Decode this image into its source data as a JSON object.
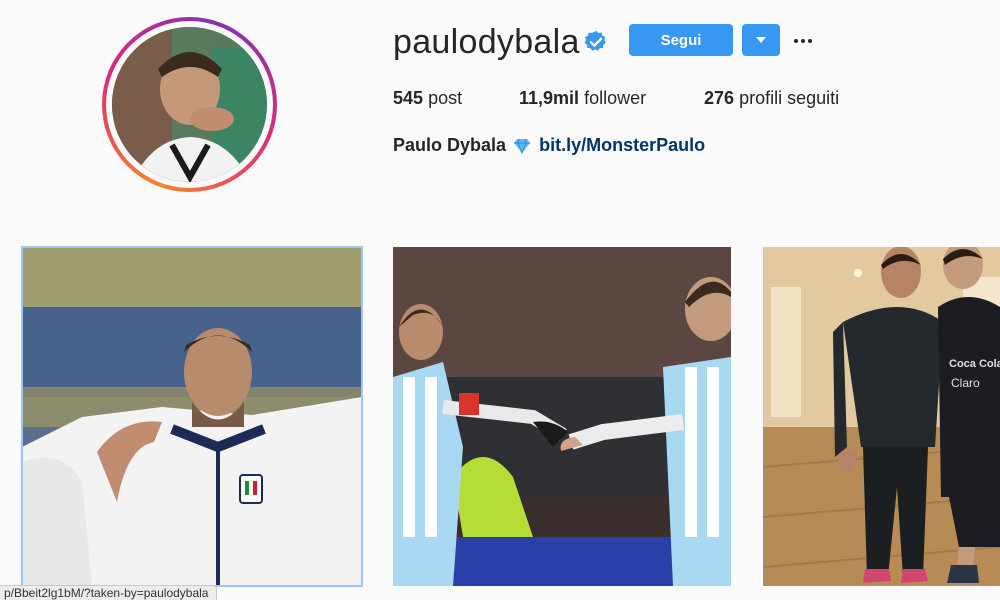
{
  "profile": {
    "username": "paulodybala",
    "verified": true,
    "follow_label": "Segui",
    "dropdown_icon": "chevron-down-icon",
    "more_icon": "more-options-icon",
    "stats": {
      "posts_value": "545",
      "posts_label": "post",
      "followers_value": "11,9mil",
      "followers_label": "follower",
      "following_value": "276",
      "following_label": "profili seguiti"
    },
    "full_name": "Paulo Dybala",
    "bio_emoji": "gem-icon",
    "bio_link": "bit.ly/MonsterPaulo"
  },
  "colors": {
    "accent": "#3897f0",
    "link": "#003569",
    "verified": "#3897f0",
    "background": "#fafafa"
  },
  "posts": [
    {
      "label": "post-giorgio-chiellini-italy-anthem"
    },
    {
      "label": "post-messi-dybala-argentina-handshake"
    },
    {
      "label": "post-del-piero-dybala-hallway"
    }
  ],
  "status_bar": {
    "url": "p/Bbeit2lg1bM/?taken-by=paulodybala"
  }
}
